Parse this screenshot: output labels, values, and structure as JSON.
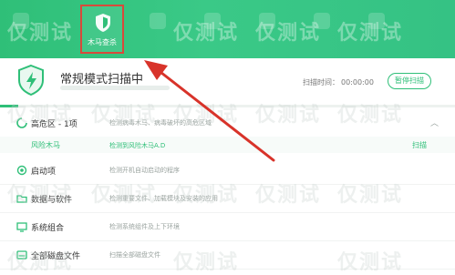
{
  "toolbar": {
    "active_tab_label": "木马查杀"
  },
  "scan": {
    "title": "常规模式扫描中",
    "elapsed_label": "扫描时间：",
    "elapsed_value": "00:00:00",
    "pause_label": "暂停扫描",
    "progress_fraction": 0.04
  },
  "sections": [
    {
      "title": "高危区 - 1项",
      "desc": "检测病毒木马、病毒破坏的高危区域",
      "icon": "spinner-icon"
    },
    {
      "title": "启动项",
      "desc": "检测开机自动启动的程序",
      "icon": "startup-icon"
    },
    {
      "title": "数据与软件",
      "desc": "检测重要文件、加载模块及安装的应用",
      "icon": "folder-icon"
    },
    {
      "title": "系统组合",
      "desc": "检测系统组件及上下环境",
      "icon": "system-icon"
    },
    {
      "title": "全部磁盘文件",
      "desc": "扫描全部磁盘文件",
      "icon": "disk-icon"
    }
  ],
  "subitem": {
    "tag": "风险木马",
    "desc": "检测到风险木马A.D",
    "action": "扫描"
  },
  "watermark": "仅测试",
  "colors": {
    "accent": "#2fbf78",
    "highlight_box": "#d84a3b",
    "arrow": "#d8332a"
  }
}
